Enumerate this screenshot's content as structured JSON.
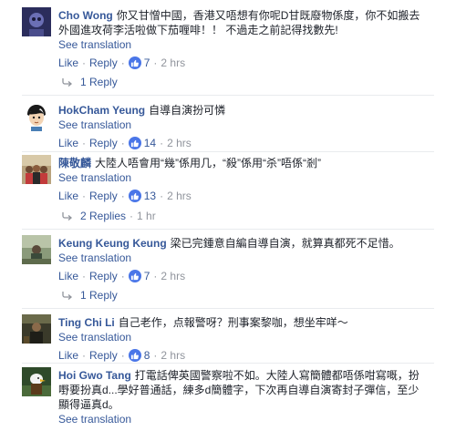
{
  "ui": {
    "see_translation": "See translation",
    "like": "Like",
    "reply": "Reply",
    "sep": "·"
  },
  "comments": [
    {
      "author": "Cho Wong",
      "text_line1": "你又甘憎中國，香港又唔想有你呢D甘既廢物係度，你不如搬去",
      "text_line2": "外國進攻荷李活啦做下茄喱啡！！ 不過走之前記得找數先!",
      "likes": "7",
      "time": "2 hrs",
      "replies": "1 Reply"
    },
    {
      "author": "HokCham Yeung",
      "text_line1": "自導自演扮可憐",
      "likes": "14",
      "time": "2 hrs"
    },
    {
      "author": "陳敬麟",
      "text_line1": "大陸人唔會用“幾”係用几，“殺”係用“杀”唔係“剎”",
      "likes": "13",
      "time": "2 hrs",
      "replies": "2 Replies",
      "replies_time": "1 hr"
    },
    {
      "author": "Keung Keung Keung",
      "text_line1": "梁已完鍾意自編自導自演，就算真都死不足惜。",
      "likes": "7",
      "time": "2 hrs",
      "replies": "1 Reply"
    },
    {
      "author": "Ting Chi Li",
      "text_line1": "自己老作，点報警呀？刑事案黎咖，想坐牢咩～",
      "likes": "8",
      "time": "2 hrs"
    },
    {
      "author": "Hoi Gwo Tang",
      "text_line1": "打電話俾英國警察啦不如。大陸人寫簡體都唔係咁寫嘅，扮",
      "text_line2": "嘢要扮真d...學好普通話，練多d簡體字，下次再自導自演寄封子彈信，至少",
      "text_line3": "顯得逼真d。"
    }
  ],
  "colors": {
    "link": "#365899",
    "meta": "#90949c",
    "text": "#1d2129",
    "like_bubble": "#4a76e8"
  }
}
